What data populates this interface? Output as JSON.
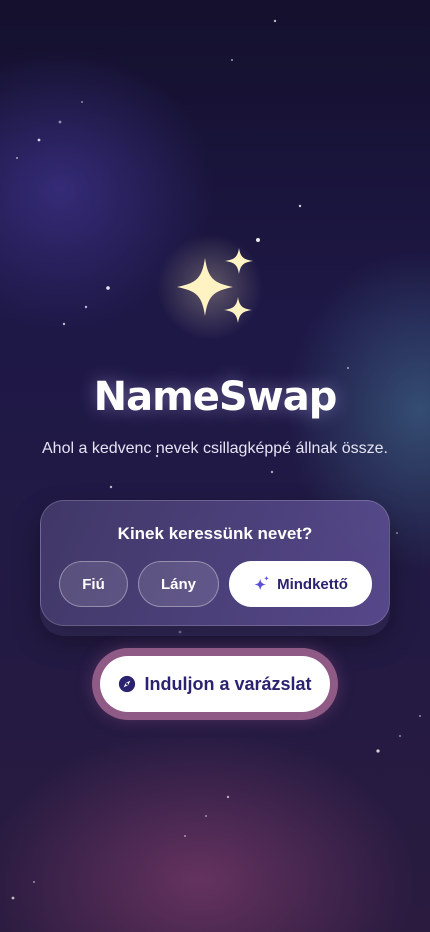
{
  "app": {
    "title": "NameSwap",
    "tagline": "Ahol a kedvenc nevek csillagképpé állnak össze."
  },
  "gender_card": {
    "question": "Kinek keressünk nevet?",
    "options": [
      {
        "label": "Fiú",
        "selected": false
      },
      {
        "label": "Lány",
        "selected": false
      },
      {
        "label": "Mindkettő",
        "selected": true,
        "icon": "sparkles-icon"
      }
    ]
  },
  "start": {
    "label": "Induljon a varázslat",
    "icon": "compass-icon"
  },
  "colors": {
    "accent": "#2b2370",
    "star": "#fff3c4",
    "ring": "#8f5b86"
  }
}
